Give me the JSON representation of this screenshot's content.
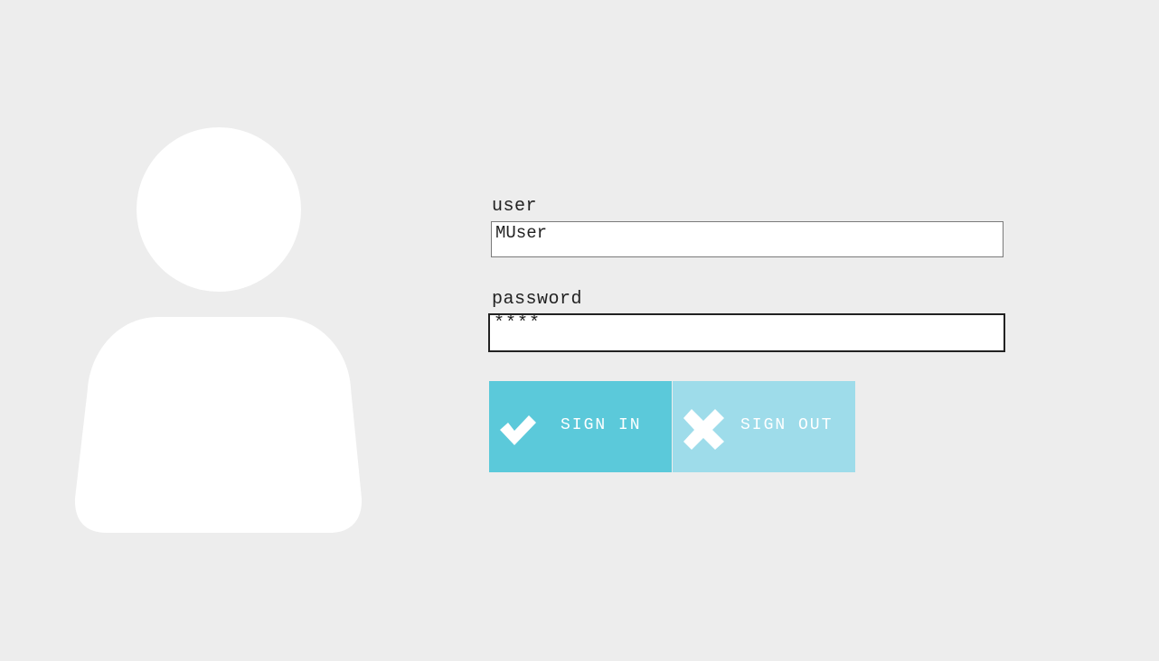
{
  "form": {
    "user_label": "user",
    "user_value": "MUser",
    "password_label": "password",
    "password_value": "****"
  },
  "buttons": {
    "sign_in_label": "SIGN IN",
    "sign_out_label": "SIGN OUT"
  },
  "icons": {
    "avatar": "user-silhouette-icon",
    "sign_in": "checkmark-icon",
    "sign_out": "x-cross-icon"
  },
  "colors": {
    "background": "#ededed",
    "sign_in_button": "#5bc9da",
    "sign_out_button": "#9edcea",
    "avatar": "#ffffff"
  }
}
